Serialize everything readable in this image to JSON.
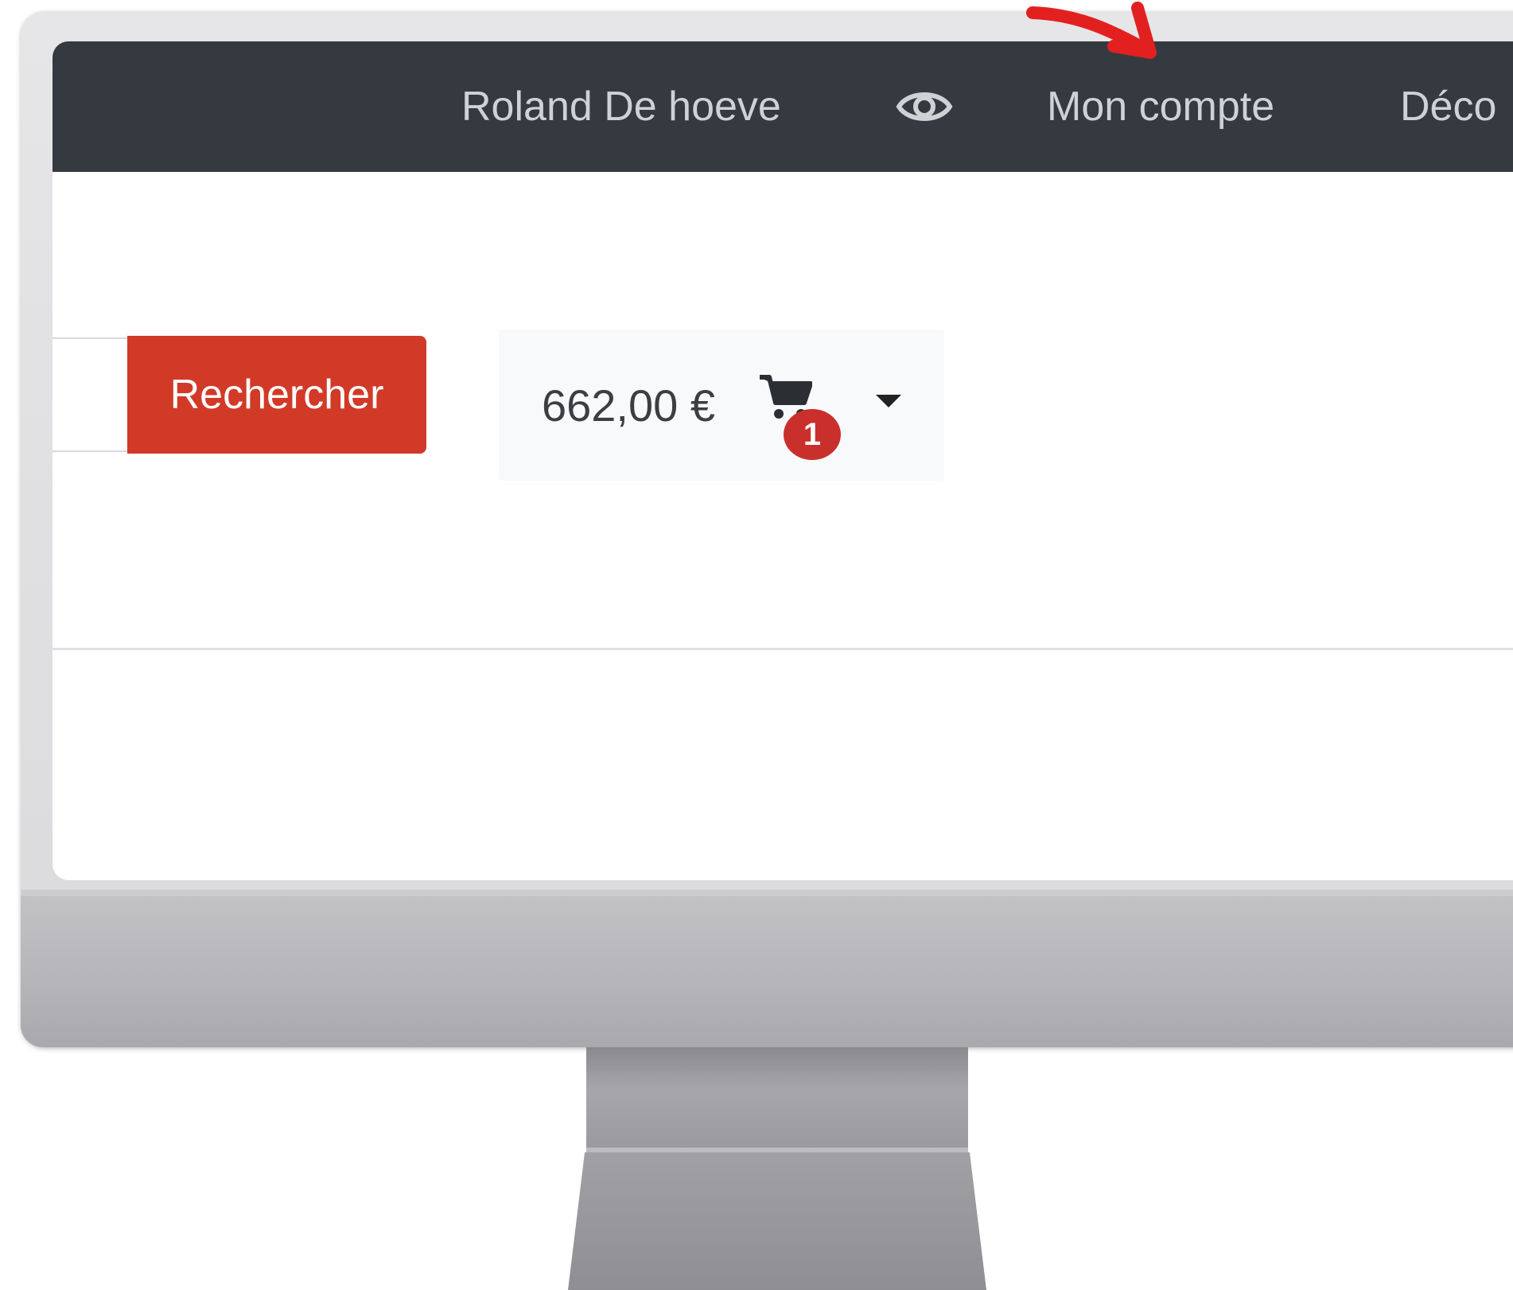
{
  "navbar": {
    "user_name": "Roland De hoeve",
    "account_link": "Mon compte",
    "logout_link": "Déco",
    "background": "#343a40",
    "icons": [
      "eye-icon"
    ]
  },
  "search": {
    "button_label": "Rechercher",
    "button_color": "#d23a28"
  },
  "cart": {
    "total": "662,00 €",
    "item_count": "1",
    "badge_color": "#c9302c",
    "icons": [
      "cart-icon",
      "caret-down-icon"
    ]
  },
  "annotation": {
    "color": "#e32020"
  }
}
